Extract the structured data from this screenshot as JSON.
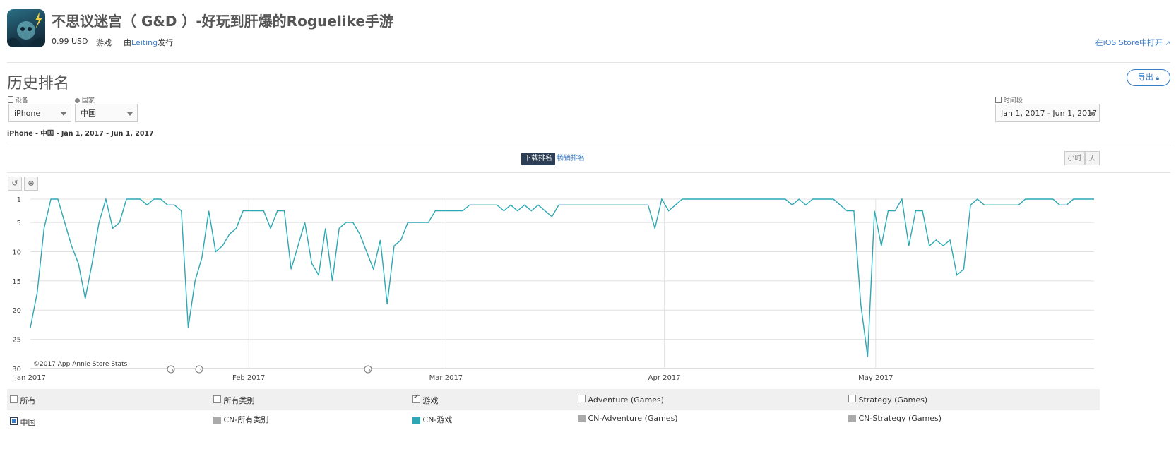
{
  "app": {
    "title": "不思议迷宫（ G&D ）-好玩到肝爆的Roguelike手游",
    "price": "0.99 USD",
    "category": "游戏",
    "publisher_prefix": "由",
    "publisher_name": "Leiting",
    "publisher_suffix": "发行",
    "ios_link": "在iOS Store中打开"
  },
  "section": {
    "title": "历史排名",
    "export_label": "导出"
  },
  "filters": {
    "device_label": "设备",
    "device_value": "iPhone",
    "country_label": "国家",
    "country_value": "中国",
    "period_label": "时间段",
    "period_value": "Jan 1, 2017 - Jun 1, 2017",
    "summary": "iPhone - 中国 - Jan 1, 2017 - Jun 1, 2017"
  },
  "tabs": {
    "active": "下载排名",
    "other": "畅销排名",
    "hour": "小时",
    "day": "天"
  },
  "chart_data": {
    "type": "line",
    "y_inverted": true,
    "ylim": [
      1,
      30
    ],
    "yticks": [
      1,
      5,
      10,
      15,
      20,
      25,
      30
    ],
    "x_range": [
      "2017-01-01",
      "2017-06-01"
    ],
    "xticks": [
      "Jan 2017",
      "Feb 2017",
      "Mar 2017",
      "Apr 2017",
      "May 2017"
    ],
    "grid": true,
    "watermark": "©2017 App Annie Store Stats",
    "series": [
      {
        "name": "CN-游戏",
        "color": "#2ba8b4",
        "values": [
          23,
          17,
          6,
          1,
          1,
          5,
          9,
          12,
          18,
          12,
          5,
          1,
          6,
          5,
          1,
          1,
          1,
          2,
          1,
          1,
          2,
          2,
          3,
          23,
          15,
          11,
          3,
          10,
          9,
          7,
          6,
          3,
          3,
          3,
          3,
          6,
          3,
          3,
          13,
          9,
          5,
          12,
          14,
          6,
          15,
          6,
          5,
          5,
          7,
          10,
          13,
          8,
          19,
          9,
          8,
          5,
          5,
          5,
          5,
          3,
          3,
          3,
          3,
          3,
          2,
          2,
          2,
          2,
          2,
          3,
          2,
          3,
          2,
          3,
          2,
          3,
          4,
          2,
          2,
          2,
          2,
          2,
          2,
          2,
          2,
          2,
          2,
          2,
          2,
          2,
          2,
          6,
          1,
          3,
          2,
          1,
          1,
          1,
          1,
          1,
          1,
          1,
          1,
          1,
          1,
          1,
          1,
          1,
          1,
          1,
          1,
          2,
          1,
          2,
          1,
          1,
          1,
          1,
          2,
          3,
          3,
          19,
          28,
          3,
          9,
          3,
          3,
          1,
          9,
          3,
          3,
          9,
          8,
          9,
          8,
          14,
          13,
          2,
          1,
          2,
          2,
          2,
          2,
          2,
          2,
          1,
          1,
          1,
          1,
          1,
          2,
          2,
          1,
          1,
          1,
          1
        ]
      }
    ],
    "annotations": [
      "marker",
      "marker",
      "marker"
    ]
  },
  "legend": {
    "categories": [
      {
        "label": "所有",
        "checked": false
      },
      {
        "label": "所有类别",
        "checked": false
      },
      {
        "label": "游戏",
        "checked": true
      },
      {
        "label": "Adventure (Games)",
        "checked": false
      },
      {
        "label": "Strategy (Games)",
        "checked": false
      }
    ],
    "country": {
      "label": "中国",
      "checked": true
    },
    "series": [
      {
        "label": "CN-所有类别",
        "color": "#aaaaaa"
      },
      {
        "label": "CN-游戏",
        "color": "#2ba8b4"
      },
      {
        "label": "CN-Adventure (Games)",
        "color": "#aaaaaa"
      },
      {
        "label": "CN-Strategy (Games)",
        "color": "#aaaaaa"
      }
    ]
  }
}
